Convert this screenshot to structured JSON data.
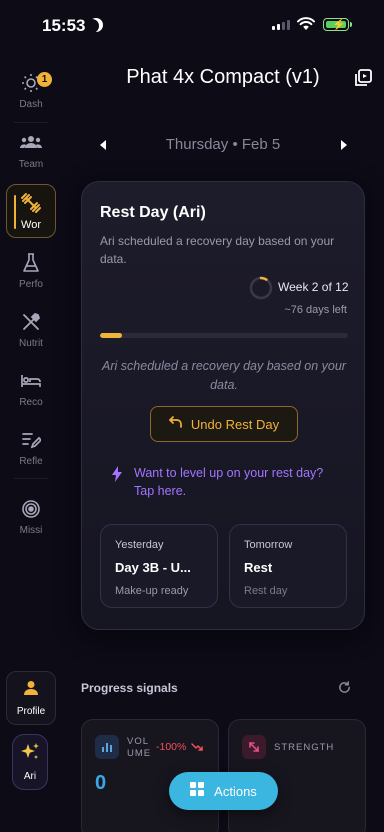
{
  "status_bar": {
    "time": "15:53"
  },
  "sidebar": {
    "items": [
      {
        "label": "Dash",
        "icon": "sun-icon",
        "badge": "1"
      },
      {
        "label": "Team",
        "icon": "team-icon"
      },
      {
        "label": "Wor",
        "icon": "dumbbell-icon",
        "active": true
      },
      {
        "label": "Perfo",
        "icon": "flask-icon"
      },
      {
        "label": "Nutrit",
        "icon": "utensils-icon"
      },
      {
        "label": "Reco",
        "icon": "bed-icon"
      },
      {
        "label": "Refle",
        "icon": "pen-lines-icon"
      },
      {
        "label": "Missi",
        "icon": "target-icon"
      }
    ],
    "profile_label": "Profile",
    "ari_label": "Ari"
  },
  "header": {
    "title": "Phat 4x Compact (v1)"
  },
  "date_nav": {
    "date": "Thursday • Feb 5"
  },
  "rest_card": {
    "title": "Rest Day (Ari)",
    "subtitle": "Ari scheduled a recovery day based on your data.",
    "week": "Week 2 of 12",
    "days_left": "~76 days left",
    "progress_fraction": 0.09,
    "note": "Ari scheduled a recovery day based on your data.",
    "undo_label": "Undo Rest Day",
    "level_up_text": "Want to level up on your rest day? Tap here.",
    "yesterday": {
      "key": "Yesterday",
      "value": "Day 3B - U...",
      "status": "Make-up ready"
    },
    "tomorrow": {
      "key": "Tomorrow",
      "value": "Rest",
      "status": "Rest day"
    }
  },
  "progress_signals": {
    "title": "Progress signals",
    "cards": [
      {
        "label": "VOLUME",
        "change": "-100%",
        "value": "0"
      },
      {
        "label": "STRENGTH"
      }
    ]
  },
  "actions": {
    "label": "Actions"
  },
  "colors": {
    "accent": "#f1b23a",
    "purple": "#a374ff",
    "action": "#3bb6e0",
    "negative": "#f0505a"
  }
}
